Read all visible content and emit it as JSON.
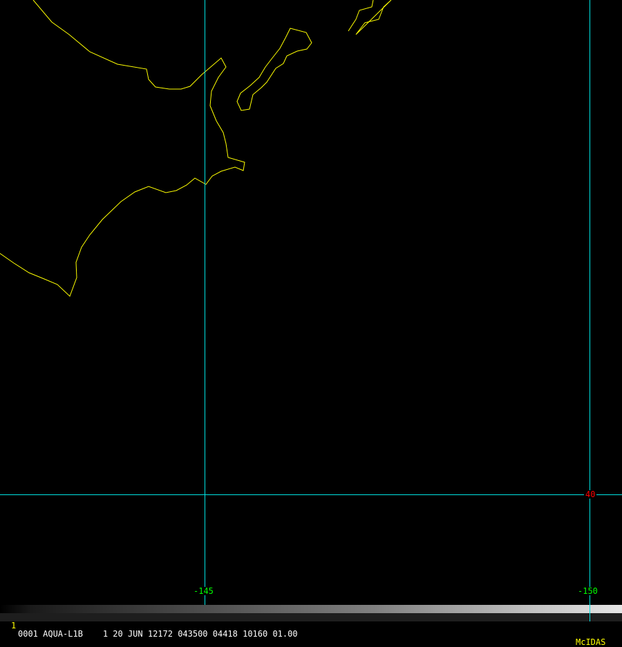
{
  "colors": {
    "coastline": "#ffff00",
    "grid": "#00e5e5",
    "lon_label": "#00ff00",
    "lat_label": "#ff0000",
    "brand": "#ffff00"
  },
  "grid": {
    "longitude_labels": [
      "-145",
      "-150"
    ],
    "latitude_labels": [
      "40"
    ]
  },
  "status_bar": {
    "frame_number": "1",
    "info": "0001 AQUA-L1B    1 20 JUN 12172 043500 04418 10160 01.00",
    "brand": "McIDAS"
  }
}
